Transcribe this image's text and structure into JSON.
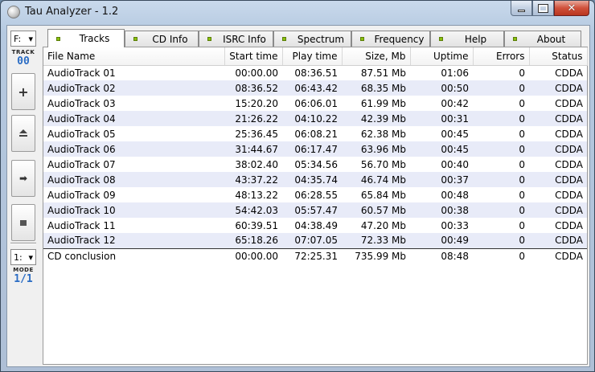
{
  "window": {
    "title": "Tau Analyzer - 1.2",
    "close_glyph": "✕"
  },
  "sidebar": {
    "drive_value": "F:",
    "track_caption": "TRACK",
    "track_number": "00",
    "buttons": [
      "plus-icon",
      "eject-icon",
      "next-icon",
      "stop-icon"
    ],
    "mode_select_value": "1:",
    "mode_caption": "MODE",
    "mode_value": "1/1"
  },
  "tabs": [
    {
      "label": "Tracks",
      "active": true
    },
    {
      "label": "CD Info",
      "active": false
    },
    {
      "label": "ISRC Info",
      "active": false
    },
    {
      "label": "Spectrum",
      "active": false
    },
    {
      "label": "Frequency",
      "active": false
    },
    {
      "label": "Help",
      "active": false
    },
    {
      "label": "About",
      "active": false
    }
  ],
  "table": {
    "columns": [
      "File Name",
      "Start time",
      "Play time",
      "Size, Mb",
      "Uptime",
      "Errors",
      "Status"
    ],
    "rows": [
      [
        "AudioTrack 01",
        "00:00.00",
        "08:36.51",
        "87.51 Mb",
        "01:06",
        "0",
        "CDDA"
      ],
      [
        "AudioTrack 02",
        "08:36.52",
        "06:43.42",
        "68.35 Mb",
        "00:50",
        "0",
        "CDDA"
      ],
      [
        "AudioTrack 03",
        "15:20.20",
        "06:06.01",
        "61.99 Mb",
        "00:42",
        "0",
        "CDDA"
      ],
      [
        "AudioTrack 04",
        "21:26.22",
        "04:10.22",
        "42.39 Mb",
        "00:31",
        "0",
        "CDDA"
      ],
      [
        "AudioTrack 05",
        "25:36.45",
        "06:08.21",
        "62.38 Mb",
        "00:45",
        "0",
        "CDDA"
      ],
      [
        "AudioTrack 06",
        "31:44.67",
        "06:17.47",
        "63.96 Mb",
        "00:45",
        "0",
        "CDDA"
      ],
      [
        "AudioTrack 07",
        "38:02.40",
        "05:34.56",
        "56.70 Mb",
        "00:40",
        "0",
        "CDDA"
      ],
      [
        "AudioTrack 08",
        "43:37.22",
        "04:35.74",
        "46.74 Mb",
        "00:37",
        "0",
        "CDDA"
      ],
      [
        "AudioTrack 09",
        "48:13.22",
        "06:28.55",
        "65.84 Mb",
        "00:48",
        "0",
        "CDDA"
      ],
      [
        "AudioTrack 10",
        "54:42.03",
        "05:57.47",
        "60.57 Mb",
        "00:38",
        "0",
        "CDDA"
      ],
      [
        "AudioTrack 11",
        "60:39.51",
        "04:38.49",
        "47.20 Mb",
        "00:33",
        "0",
        "CDDA"
      ],
      [
        "AudioTrack 12",
        "65:18.26",
        "07:07.05",
        "72.33 Mb",
        "00:49",
        "0",
        "CDDA"
      ]
    ],
    "summary": [
      "CD conclusion",
      "00:00.00",
      "72:25.31",
      "735.99 Mb",
      "08:48",
      "0",
      "CDDA"
    ]
  },
  "colors": {
    "accent": "#2a6cc4",
    "tab_led": "#8ac10f",
    "row_alt": "#e8ebf8"
  }
}
